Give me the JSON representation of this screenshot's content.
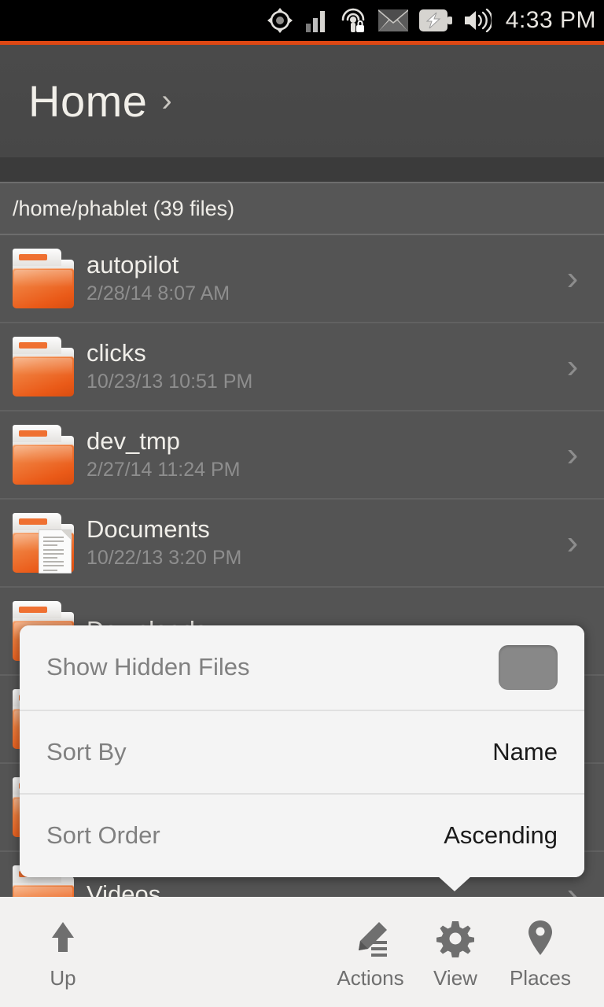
{
  "statusbar": {
    "time": "4:33 PM",
    "icons": [
      "location-icon",
      "cellular-signal-icon",
      "wifi-locked-icon",
      "message-icon",
      "battery-charging-icon",
      "volume-icon"
    ]
  },
  "header": {
    "title": "Home",
    "chevron": "›"
  },
  "pathbar": {
    "text": "/home/phablet (39 files)"
  },
  "files": [
    {
      "name": "autopilot",
      "date": "2/28/14 8:07 AM",
      "icon": "folder-icon",
      "chevron": "›"
    },
    {
      "name": "clicks",
      "date": "10/23/13 10:51 PM",
      "icon": "folder-icon",
      "chevron": "›"
    },
    {
      "name": "dev_tmp",
      "date": "2/27/14 11:24 PM",
      "icon": "folder-icon",
      "chevron": "›"
    },
    {
      "name": "Documents",
      "date": "10/22/13 3:20 PM",
      "icon": "folder-document-icon",
      "chevron": "›"
    },
    {
      "name": "Downloads",
      "date": "",
      "icon": "folder-icon",
      "chevron": "›"
    },
    {
      "name": "",
      "date": "",
      "icon": "folder-icon",
      "chevron": "›"
    },
    {
      "name": "",
      "date": "",
      "icon": "folder-icon",
      "chevron": "›"
    },
    {
      "name": "Videos",
      "date": "",
      "icon": "folder-icon",
      "chevron": "›"
    }
  ],
  "dialog": {
    "rows": [
      {
        "label": "Show Hidden Files",
        "value": "",
        "control": "checkbox",
        "checked": false
      },
      {
        "label": "Sort By",
        "value": "Name",
        "control": "value"
      },
      {
        "label": "Sort Order",
        "value": "Ascending",
        "control": "value"
      }
    ]
  },
  "toolbar": {
    "items": [
      {
        "label": "Up",
        "icon": "arrow-up-icon"
      },
      {
        "label": "Actions",
        "icon": "pencil-icon"
      },
      {
        "label": "View",
        "icon": "gear-icon"
      },
      {
        "label": "Places",
        "icon": "map-pin-icon"
      }
    ]
  },
  "colors": {
    "accent": "#dd4814",
    "folder": "#ea5a18",
    "list_bg": "#545454",
    "dialog_bg": "#f4f4f4",
    "toolbar_bg": "#f2f1f0"
  }
}
